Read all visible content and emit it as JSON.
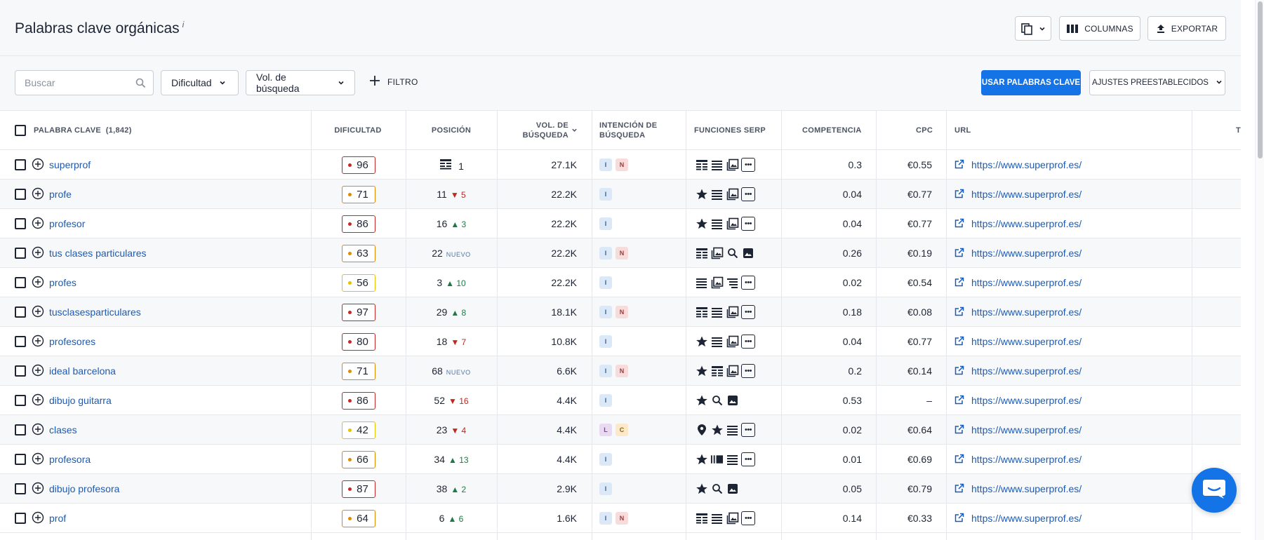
{
  "header": {
    "title": "Palabras clave orgánicas",
    "title_info": "i",
    "columns_label": "COLUMNAS",
    "export_label": "EXPORTAR"
  },
  "toolbar": {
    "search_placeholder": "Buscar",
    "difficulty_label": "Dificultad",
    "volume_label": "Vol. de búsqueda",
    "filter_label": "FILTRO",
    "use_keywords_label": "USAR PALABRAS CLAVE",
    "presets_label": "AJUSTES PREESTABLECIDOS"
  },
  "columns": {
    "keyword": "PALABRA CLAVE",
    "keyword_count": "(1,842)",
    "difficulty": "DIFICULTAD",
    "position": "POSICIÓN",
    "volume_line1": "VOL. DE",
    "volume_line2": "BÚSQUEDA",
    "intent_line1": "INTENCIÓN DE",
    "intent_line2": "BÚSQUEDA",
    "serp": "FUNCIONES SERP",
    "competition": "COMPETENCIA",
    "cpc": "CPC",
    "url": "URL",
    "cut_off": "T"
  },
  "colors": {
    "accent": "#1473e6",
    "link": "#1a5bb8",
    "diff_red": "#c62828",
    "diff_orange": "#e08a00",
    "diff_yellow": "#e6c200",
    "up": "#1d7a45",
    "down": "#c0281e"
  },
  "rows": [
    {
      "keyword": "superprof",
      "difficulty": "96",
      "diff_level": "red",
      "position": "1",
      "pos_icon": "featured-snippet",
      "change": "",
      "change_dir": "",
      "volume": "27.1K",
      "intents": [
        "I",
        "N"
      ],
      "serp": [
        "table",
        "lines",
        "image-pack",
        "more"
      ],
      "competition": "0.3",
      "cpc": "€0.55",
      "url": "https://www.superprof.es/"
    },
    {
      "keyword": "profe",
      "difficulty": "71",
      "diff_level": "orange",
      "position": "11",
      "change": "5",
      "change_dir": "down",
      "volume": "22.2K",
      "intents": [
        "I"
      ],
      "serp": [
        "star",
        "lines",
        "image-pack",
        "more"
      ],
      "competition": "0.04",
      "cpc": "€0.77",
      "url": "https://www.superprof.es/"
    },
    {
      "keyword": "profesor",
      "difficulty": "86",
      "diff_level": "red",
      "position": "16",
      "change": "3",
      "change_dir": "up",
      "volume": "22.2K",
      "intents": [
        "I"
      ],
      "serp": [
        "star",
        "lines",
        "image-pack",
        "more"
      ],
      "competition": "0.04",
      "cpc": "€0.77",
      "url": "https://www.superprof.es/"
    },
    {
      "keyword": "tus clases particulares",
      "difficulty": "63",
      "diff_level": "orange",
      "position": "22",
      "change": "NUEVO",
      "change_dir": "new",
      "volume": "22.2K",
      "intents": [
        "I",
        "N"
      ],
      "serp": [
        "table",
        "image-pack",
        "search",
        "image"
      ],
      "competition": "0.26",
      "cpc": "€0.19",
      "url": "https://www.superprof.es/"
    },
    {
      "keyword": "profes",
      "difficulty": "56",
      "diff_level": "yellow",
      "position": "3",
      "change": "10",
      "change_dir": "up",
      "volume": "22.2K",
      "intents": [
        "I"
      ],
      "serp": [
        "lines",
        "image-pack",
        "list",
        "more"
      ],
      "competition": "0.02",
      "cpc": "€0.54",
      "url": "https://www.superprof.es/"
    },
    {
      "keyword": "tusclasesparticulares",
      "difficulty": "97",
      "diff_level": "red",
      "position": "29",
      "change": "8",
      "change_dir": "up",
      "volume": "18.1K",
      "intents": [
        "I",
        "N"
      ],
      "serp": [
        "table",
        "lines",
        "image-pack",
        "more"
      ],
      "competition": "0.18",
      "cpc": "€0.08",
      "url": "https://www.superprof.es/"
    },
    {
      "keyword": "profesores",
      "difficulty": "80",
      "diff_level": "red",
      "position": "18",
      "change": "7",
      "change_dir": "down",
      "volume": "10.8K",
      "intents": [
        "I"
      ],
      "serp": [
        "star",
        "lines",
        "image-pack",
        "more"
      ],
      "competition": "0.04",
      "cpc": "€0.77",
      "url": "https://www.superprof.es/"
    },
    {
      "keyword": "ideal barcelona",
      "difficulty": "71",
      "diff_level": "orange",
      "position": "68",
      "change": "NUEVO",
      "change_dir": "new",
      "volume": "6.6K",
      "intents": [
        "I",
        "N"
      ],
      "serp": [
        "star",
        "table",
        "image-pack",
        "more"
      ],
      "competition": "0.2",
      "cpc": "€0.14",
      "url": "https://www.superprof.es/"
    },
    {
      "keyword": "dibujo guitarra",
      "difficulty": "86",
      "diff_level": "red",
      "position": "52",
      "change": "16",
      "change_dir": "down",
      "volume": "4.4K",
      "intents": [
        "I"
      ],
      "serp": [
        "star",
        "search",
        "image"
      ],
      "competition": "0.53",
      "cpc": "–",
      "url": "https://www.superprof.es/"
    },
    {
      "keyword": "clases",
      "difficulty": "42",
      "diff_level": "yellow",
      "position": "23",
      "change": "4",
      "change_dir": "down",
      "volume": "4.4K",
      "intents": [
        "L",
        "C"
      ],
      "serp": [
        "pin",
        "star",
        "lines",
        "more"
      ],
      "competition": "0.02",
      "cpc": "€0.64",
      "url": "https://www.superprof.es/"
    },
    {
      "keyword": "profesora",
      "difficulty": "66",
      "diff_level": "orange",
      "position": "34",
      "change": "13",
      "change_dir": "up",
      "volume": "4.4K",
      "intents": [
        "I"
      ],
      "serp": [
        "star",
        "video",
        "lines",
        "more"
      ],
      "competition": "0.01",
      "cpc": "€0.69",
      "url": "https://www.superprof.es/"
    },
    {
      "keyword": "dibujo profesora",
      "difficulty": "87",
      "diff_level": "red",
      "position": "38",
      "change": "2",
      "change_dir": "up",
      "volume": "2.9K",
      "intents": [
        "I"
      ],
      "serp": [
        "star",
        "search",
        "image"
      ],
      "competition": "0.05",
      "cpc": "€0.79",
      "url": "https://www.superprof.es/"
    },
    {
      "keyword": "prof",
      "difficulty": "64",
      "diff_level": "orange",
      "position": "6",
      "change": "6",
      "change_dir": "up",
      "volume": "1.6K",
      "intents": [
        "I",
        "N"
      ],
      "serp": [
        "table",
        "lines",
        "image-pack",
        "more"
      ],
      "competition": "0.14",
      "cpc": "€0.33",
      "url": "https://www.superprof.es/"
    }
  ]
}
